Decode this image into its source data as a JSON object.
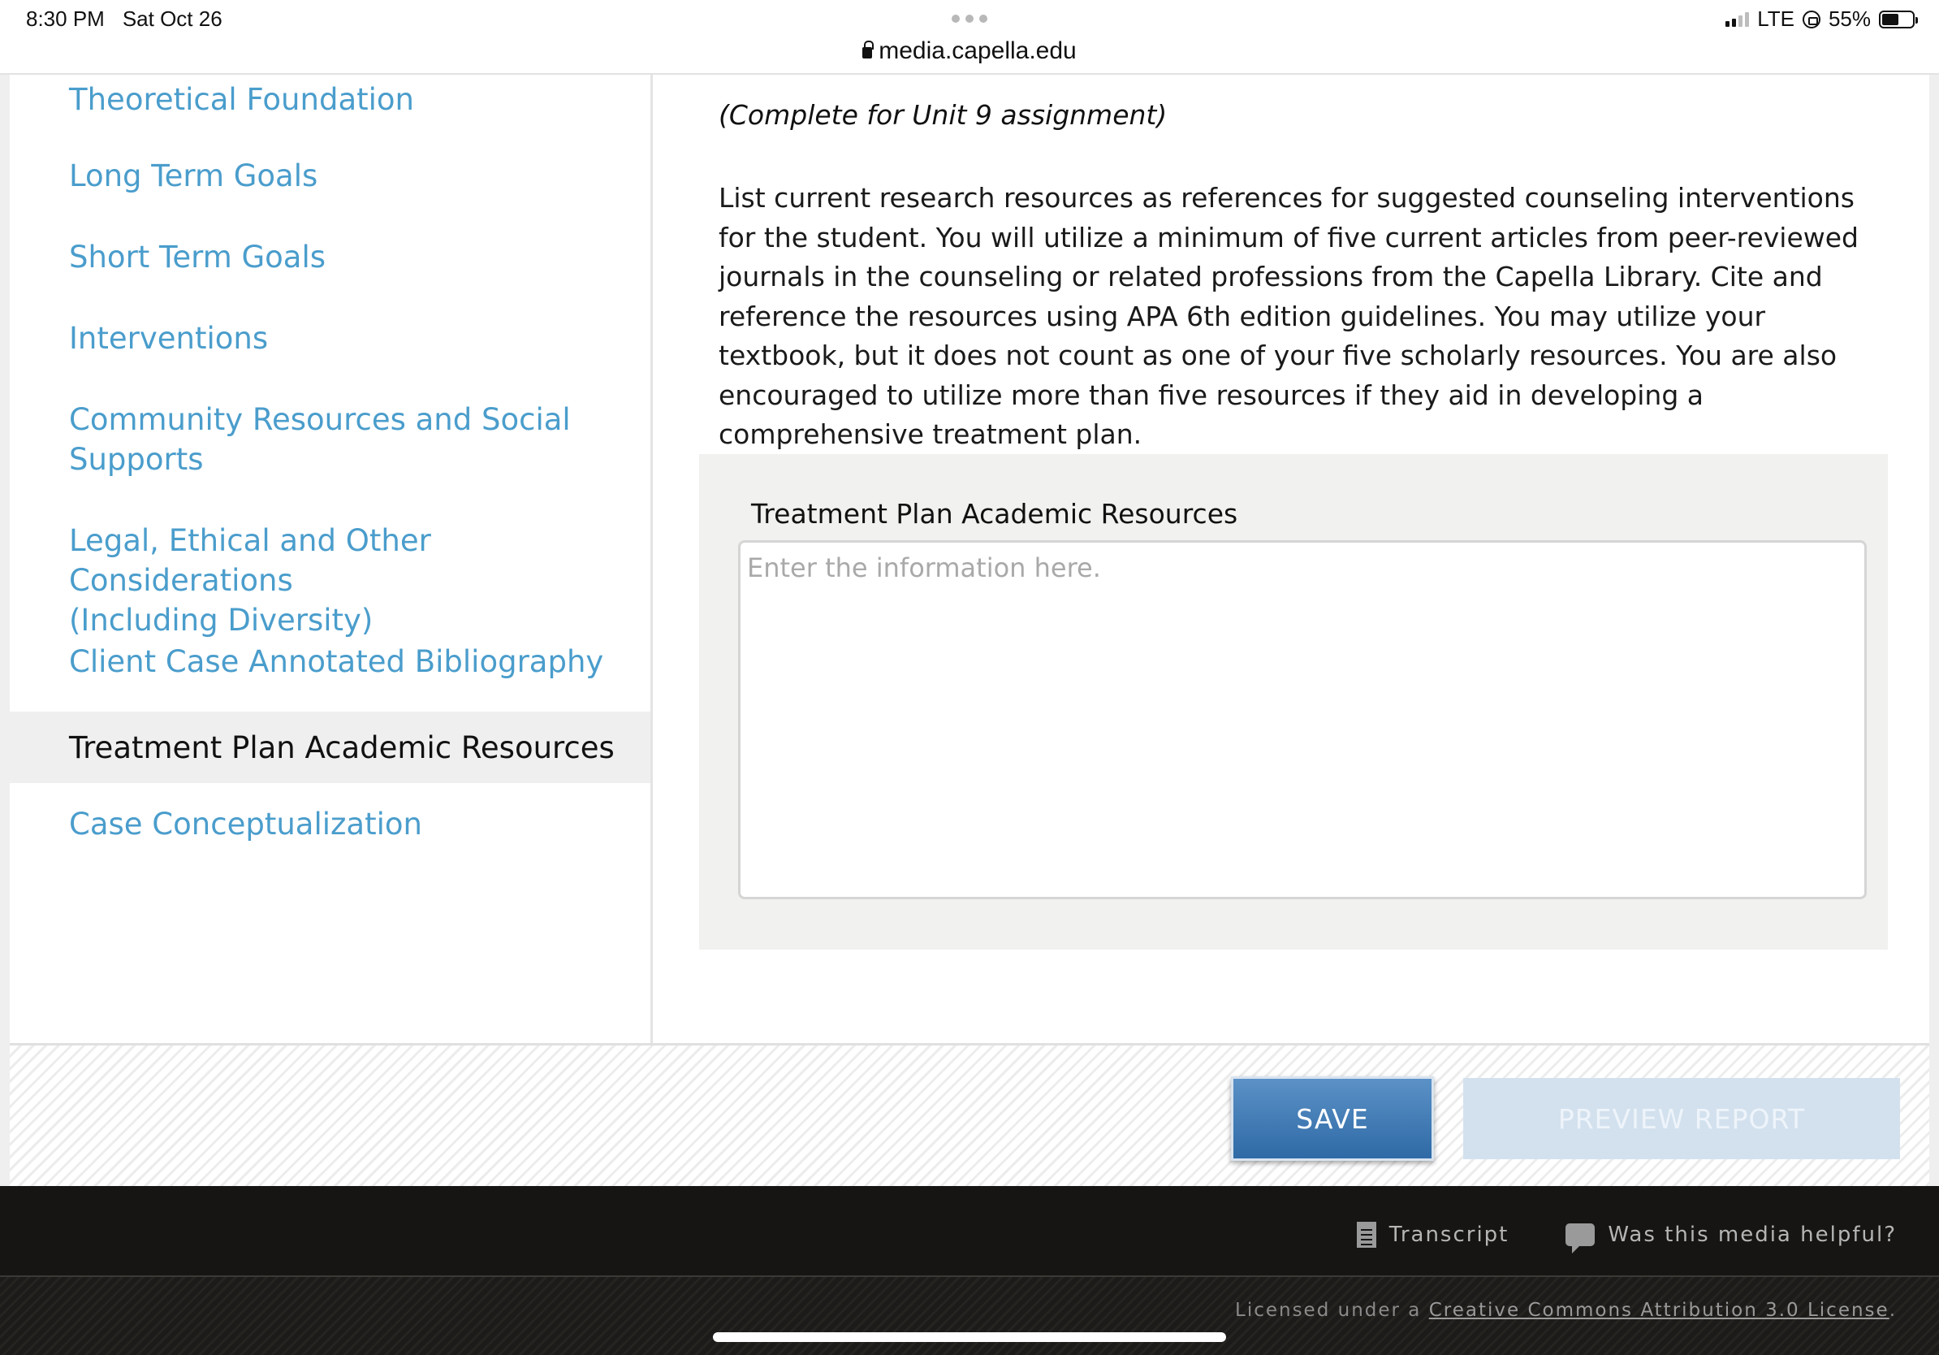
{
  "status_bar": {
    "time": "8:30 PM",
    "date": "Sat Oct 26",
    "url": "media.capella.edu",
    "network": "LTE",
    "battery": "55%",
    "battery_level": 0.55
  },
  "sidebar": {
    "items": [
      {
        "label": "Theoretical Foundation"
      },
      {
        "label": "Long Term Goals"
      },
      {
        "label": "Short Term Goals"
      },
      {
        "label": "Interventions"
      },
      {
        "label": "Community Resources and Social",
        "label2": "Supports"
      },
      {
        "label": "Legal, Ethical and Other Considerations",
        "label2": "(Including Diversity)"
      },
      {
        "label": "Client Case Annotated Bibliography"
      },
      {
        "label": "Treatment Plan Academic Resources",
        "active": true
      },
      {
        "label": "Case Conceptualization"
      }
    ]
  },
  "main": {
    "instruction": "(Complete for Unit 9 assignment)",
    "description": "List current research resources as references for suggested counseling interventions for the student. You will utilize a minimum of five current articles from peer-reviewed journals in the counseling or related professions from the Capella Library. Cite and reference the resources using APA 6th edition guidelines. You may utilize your textbook, but it does not count as one of your five scholarly resources. You are also encouraged to utilize more than five resources if they aid in developing a comprehensive treatment plan.",
    "field": {
      "label": "Treatment Plan Academic Resources",
      "placeholder": "Enter the information here.",
      "value": ""
    }
  },
  "actions": {
    "save_label": "SAVE",
    "preview_label": "PREVIEW REPORT"
  },
  "footer": {
    "transcript_label": "Transcript",
    "helpful_label": "Was this media helpful?",
    "license_prefix": "Licensed under a ",
    "license_link": "Creative Commons Attribution 3.0 License",
    "license_suffix": "."
  },
  "colors": {
    "link": "#4a9dcc",
    "save_button": "#3a74b0",
    "preview_button": "#d3e1ee",
    "footer": "#161513"
  },
  "icons": [
    "lock-icon",
    "signal-icon",
    "orientation-lock-icon",
    "battery-icon",
    "document-icon",
    "speech-bubble-icon"
  ]
}
